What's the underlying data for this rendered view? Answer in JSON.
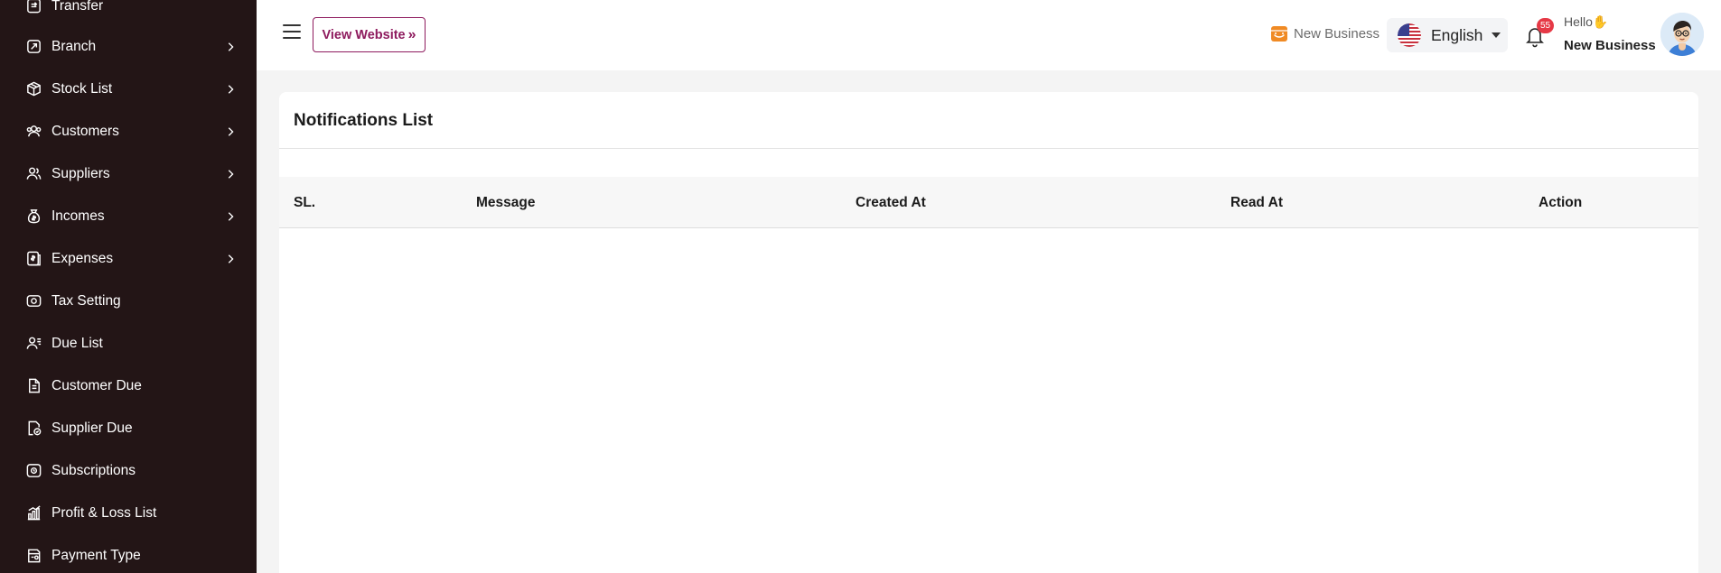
{
  "sidebar": {
    "items": [
      {
        "label": "Transfer",
        "icon": "transfer-icon",
        "has_submenu": false
      },
      {
        "label": "Branch",
        "icon": "branch-icon",
        "has_submenu": true
      },
      {
        "label": "Stock List",
        "icon": "box-icon",
        "has_submenu": true
      },
      {
        "label": "Customers",
        "icon": "users-icon",
        "has_submenu": true
      },
      {
        "label": "Suppliers",
        "icon": "user-group-icon",
        "has_submenu": true
      },
      {
        "label": "Incomes",
        "icon": "money-bag-icon",
        "has_submenu": true
      },
      {
        "label": "Expenses",
        "icon": "expense-receipt-icon",
        "has_submenu": true
      },
      {
        "label": "Tax Setting",
        "icon": "tax-icon",
        "has_submenu": false
      },
      {
        "label": "Due List",
        "icon": "user-list-icon",
        "has_submenu": false
      },
      {
        "label": "Customer Due",
        "icon": "document-icon",
        "has_submenu": false
      },
      {
        "label": "Supplier Due",
        "icon": "document-check-icon",
        "has_submenu": false
      },
      {
        "label": "Subscriptions",
        "icon": "subscription-icon",
        "has_submenu": false
      },
      {
        "label": "Profit & Loss List",
        "icon": "bar-chart-icon",
        "has_submenu": false
      },
      {
        "label": "Payment Type",
        "icon": "payment-icon",
        "has_submenu": false
      }
    ]
  },
  "header": {
    "view_website_label": "View Website",
    "business_label": "New Business",
    "language": "English",
    "notification_count": "55",
    "greeting": "Hello",
    "greeting_emoji": "✋",
    "user_name": "New Business"
  },
  "main": {
    "title": "Notifications List",
    "columns": [
      "SL.",
      "Message",
      "Created At",
      "Read At",
      "Action"
    ]
  },
  "colors": {
    "sidebar_bg": "#231516",
    "accent": "#8e1b5e",
    "badge": "#e63946",
    "store_icon": "#f08a24"
  }
}
